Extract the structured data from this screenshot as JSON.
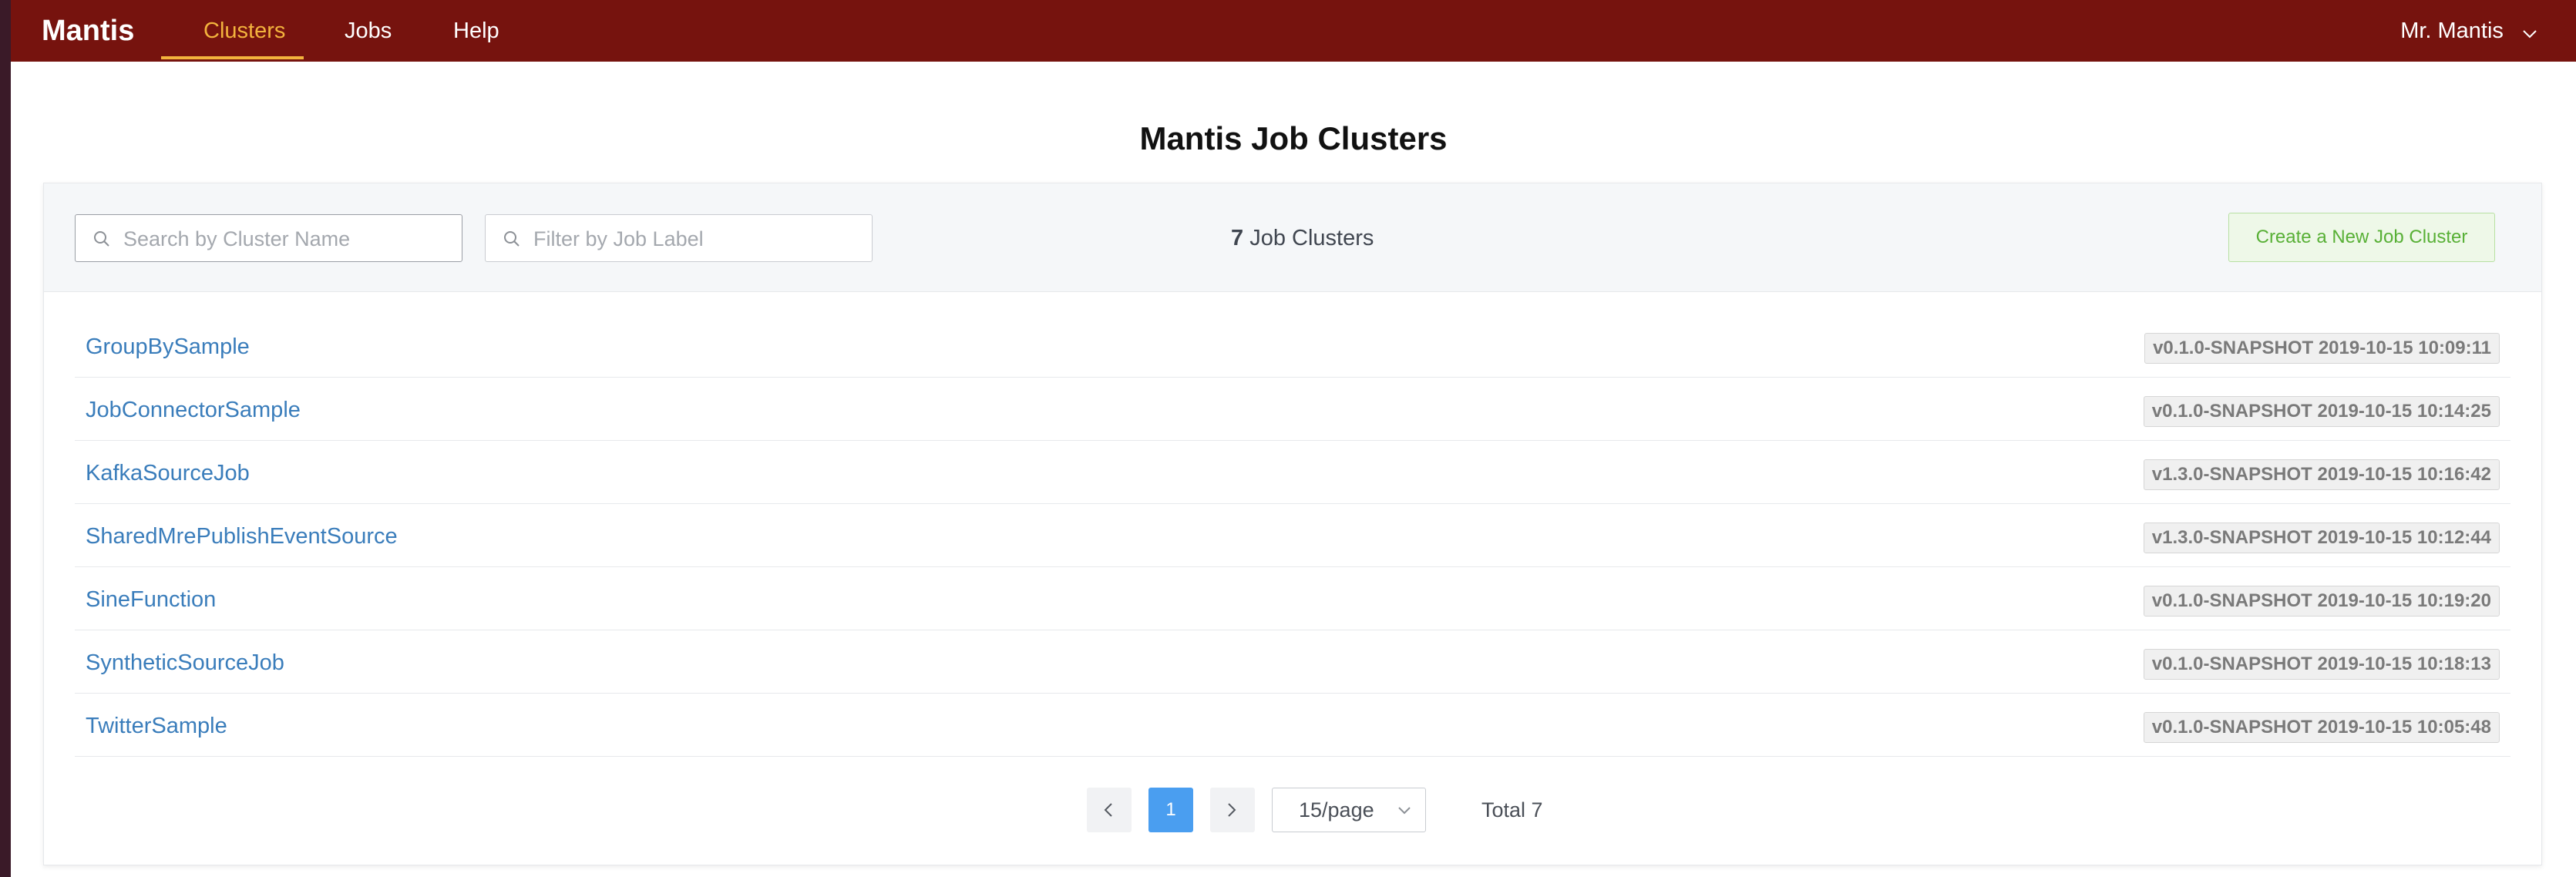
{
  "nav": {
    "brand": "Mantis",
    "items": [
      {
        "label": "Clusters",
        "active": true
      },
      {
        "label": "Jobs",
        "active": false
      },
      {
        "label": "Help",
        "active": false
      }
    ],
    "user": "Mr. Mantis"
  },
  "page": {
    "title": "Mantis Job Clusters"
  },
  "toolbar": {
    "search_placeholder": "Search by Cluster Name",
    "filter_placeholder": "Filter by Job Label",
    "count_number": "7",
    "count_label": "Job Clusters",
    "create_label": "Create a New Job Cluster"
  },
  "clusters": [
    {
      "name": "GroupBySample",
      "version": "v0.1.0-SNAPSHOT 2019-10-15 10:09:11"
    },
    {
      "name": "JobConnectorSample",
      "version": "v0.1.0-SNAPSHOT 2019-10-15 10:14:25"
    },
    {
      "name": "KafkaSourceJob",
      "version": "v1.3.0-SNAPSHOT 2019-10-15 10:16:42"
    },
    {
      "name": "SharedMrePublishEventSource",
      "version": "v1.3.0-SNAPSHOT 2019-10-15 10:12:44"
    },
    {
      "name": "SineFunction",
      "version": "v0.1.0-SNAPSHOT 2019-10-15 10:19:20"
    },
    {
      "name": "SyntheticSourceJob",
      "version": "v0.1.0-SNAPSHOT 2019-10-15 10:18:13"
    },
    {
      "name": "TwitterSample",
      "version": "v0.1.0-SNAPSHOT 2019-10-15 10:05:48"
    }
  ],
  "pagination": {
    "current_page": "1",
    "page_size": "15/page",
    "total": "Total 7"
  },
  "colors": {
    "topbar": "#76130e",
    "active_nav": "#f3b33d",
    "link": "#3a7dbb",
    "primary": "#4a9ef0",
    "create_button_text": "#58b036"
  }
}
